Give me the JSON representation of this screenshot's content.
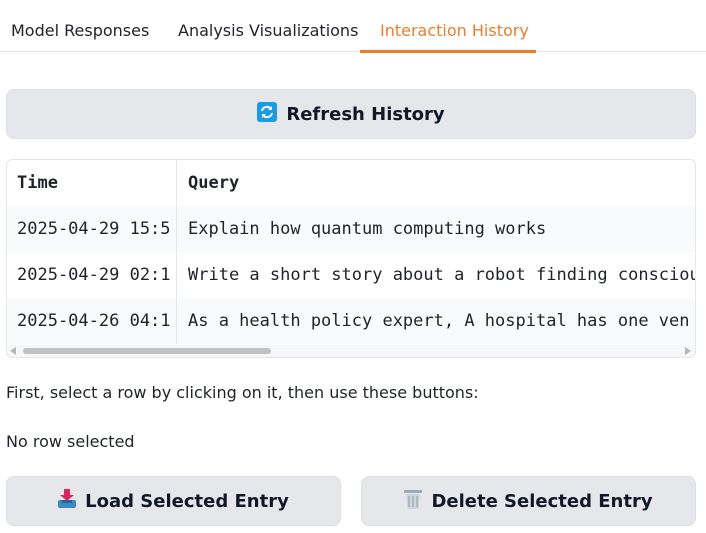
{
  "tabs": [
    {
      "label": "Model Responses",
      "active": false
    },
    {
      "label": "Analysis Visualizations",
      "active": false
    },
    {
      "label": "Interaction History",
      "active": true
    }
  ],
  "refresh_button": {
    "label": "Refresh History",
    "icon": "refresh-icon"
  },
  "table": {
    "columns": [
      "Time",
      "Query"
    ],
    "rows": [
      {
        "time": "2025-04-29 15:5",
        "query": "Explain how quantum computing works"
      },
      {
        "time": "2025-04-29 02:1",
        "query": "Write a short story about a robot finding consciou"
      },
      {
        "time": "2025-04-26 04:1",
        "query": "As a health policy expert, A hospital has one ven"
      }
    ],
    "horizontal_scroll_fraction": 0.36
  },
  "instructions": "First, select a row by clicking on it, then use these buttons:",
  "selection_status": "No row selected",
  "load_button": {
    "label": "Load Selected Entry",
    "icon": "inbox-tray-icon"
  },
  "delete_button": {
    "label": "Delete Selected Entry",
    "icon": "wastebasket-icon"
  },
  "colors": {
    "accent": "#f07c2a",
    "button_bg": "#e5e7eb"
  }
}
